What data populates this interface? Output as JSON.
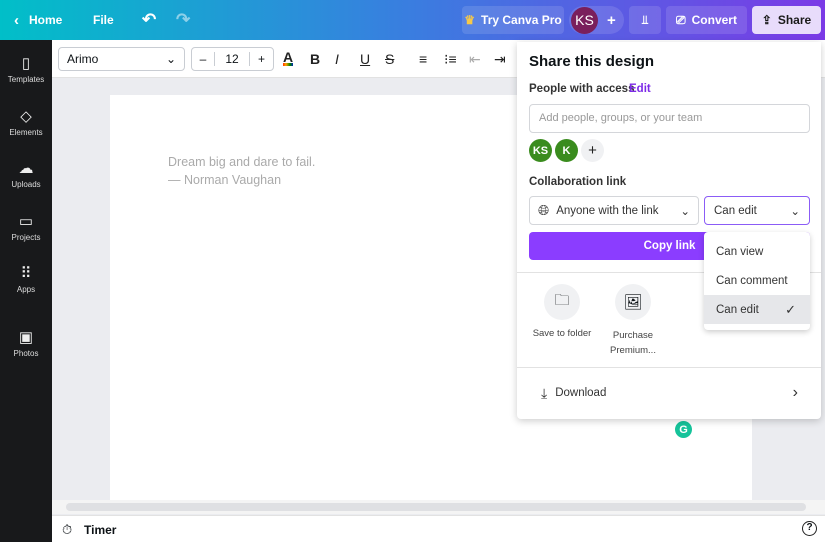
{
  "topbar": {
    "home": "Home",
    "file": "File",
    "try_pro": "Try Canva Pro",
    "avatar": "KS",
    "convert": "Convert",
    "share": "Share"
  },
  "sidebar": [
    {
      "label": "Templates",
      "icon": "▯"
    },
    {
      "label": "Elements",
      "icon": "◇"
    },
    {
      "label": "Uploads",
      "icon": "☁"
    },
    {
      "label": "Projects",
      "icon": "▭"
    },
    {
      "label": "Apps",
      "icon": "⠿"
    },
    {
      "label": "Photos",
      "icon": "▣"
    }
  ],
  "toolbar": {
    "font": "Arimo",
    "size": "12",
    "minus": "–",
    "plus": "+"
  },
  "page": {
    "quote_line1": "Dream big and dare to fail.",
    "quote_line2": "— Norman Vaughan"
  },
  "share": {
    "title": "Share this design",
    "people_label": "People with access",
    "edit": "Edit",
    "add_placeholder": "Add people, groups, or your team",
    "avatars": [
      "KS",
      "K"
    ],
    "collab_label": "Collaboration link",
    "link_scope": "Anyone with the link",
    "permission": "Can edit",
    "copy_link": "Copy link",
    "save_folder": "Save to folder",
    "purchase_1": "Purchase",
    "purchase_2": "Premium...",
    "download": "Download"
  },
  "permission_menu": [
    "Can view",
    "Can comment",
    "Can edit"
  ],
  "bottom": {
    "timer": "Timer",
    "help": "?"
  },
  "colors": {
    "accent": "#7d2ae8",
    "avatar_green": "#3a8c1e"
  }
}
